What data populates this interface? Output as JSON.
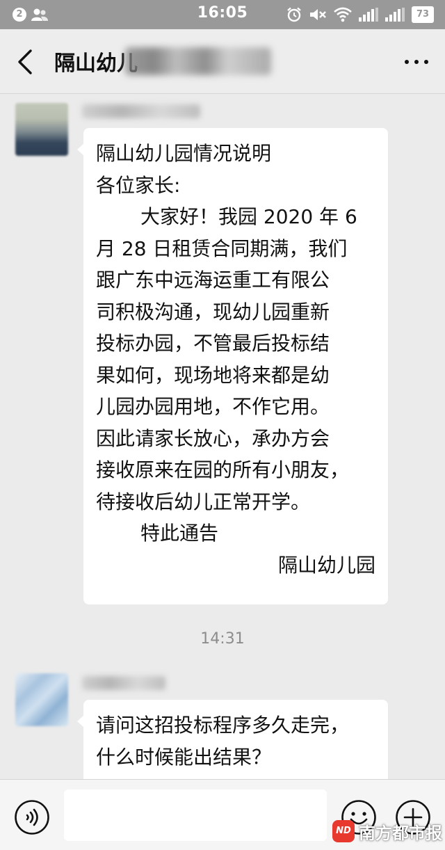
{
  "status_bar": {
    "time": "16:05",
    "notification_count": "2",
    "battery": "73",
    "icons": [
      "people-icon",
      "alarm-icon",
      "mute-icon",
      "wifi-icon",
      "signal-icon",
      "signal-icon",
      "battery-icon"
    ]
  },
  "header": {
    "title": "隔山幼儿",
    "icons": [
      "back-icon",
      "more-icon"
    ]
  },
  "messages": [
    {
      "lines": [
        "隔山幼儿园情况说明",
        "各位家长:",
        "大家好！我园 2020 年 6",
        "月 28 日租赁合同期满，我们",
        "跟广东中远海运重工有限公",
        "司积极沟通，现幼儿园重新",
        "投标办园，不管最后投标结",
        "果如何，现场地将来都是幼",
        "儿园办园用地，不作它用。",
        "因此请家长放心，承办方会",
        "接收原来在园的所有小朋友，",
        "待接收后幼儿正常开学。",
        "特此通告",
        "隔山幼儿园"
      ]
    },
    {
      "lines": [
        "请问这招投标程序多久走完，",
        "什么时候能出结果？"
      ]
    }
  ],
  "timestamp": "14:31",
  "input_bar": {
    "value": "",
    "icons": [
      "voice-icon",
      "emoji-icon",
      "plus-icon"
    ]
  },
  "watermark": {
    "logo": "ND",
    "text": "南方都市报"
  },
  "colors": {
    "status_bar_bg": "#999999",
    "chat_bg": "#ebebeb",
    "bubble_bg": "#ffffff",
    "watermark_red": "#e8392e"
  }
}
